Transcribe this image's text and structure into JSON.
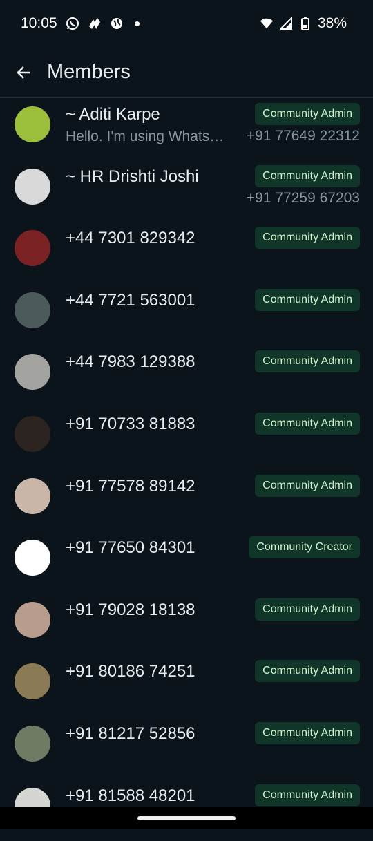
{
  "status_bar": {
    "time": "10:05",
    "battery": "38%",
    "icons": [
      "whatsapp-icon",
      "app-icon",
      "globe-icon",
      "dot-icon",
      "wifi-icon",
      "signal-icon",
      "battery-icon"
    ]
  },
  "header": {
    "title": "Members",
    "back_icon": "arrow-left-icon"
  },
  "members": [
    {
      "name": "~ Aditi Karpe",
      "about": "Hello. I'm using WhatsApp.",
      "badge": "Community Admin",
      "phone": "+91 77649 22312",
      "avatar_color": "#9bbf3a"
    },
    {
      "name": "~ HR Drishti Joshi",
      "about": "",
      "badge": "Community Admin",
      "phone": "+91 77259 67203",
      "avatar_color": "#d9d9d9"
    },
    {
      "name": "+44 7301 829342",
      "about": "",
      "badge": "Community Admin",
      "phone": "",
      "avatar_color": "#7a2224"
    },
    {
      "name": "+44 7721 563001",
      "about": "",
      "badge": "Community Admin",
      "phone": "",
      "avatar_color": "#4d5a5c"
    },
    {
      "name": "+44 7983 129388",
      "about": "",
      "badge": "Community Admin",
      "phone": "",
      "avatar_color": "#a3a3a0"
    },
    {
      "name": "+91 70733 81883",
      "about": "",
      "badge": "Community Admin",
      "phone": "",
      "avatar_color": "#2b2420"
    },
    {
      "name": "+91 77578 89142",
      "about": "",
      "badge": "Community Admin",
      "phone": "",
      "avatar_color": "#c9b6a8"
    },
    {
      "name": "+91 77650 84301",
      "about": "",
      "badge": "Community Creator",
      "phone": "",
      "avatar_color": "#ffffff"
    },
    {
      "name": "+91 79028 18138",
      "about": "",
      "badge": "Community Admin",
      "phone": "",
      "avatar_color": "#b89d8f"
    },
    {
      "name": "+91 80186 74251",
      "about": "",
      "badge": "Community Admin",
      "phone": "",
      "avatar_color": "#8a7a55"
    },
    {
      "name": "+91 81217 52856",
      "about": "",
      "badge": "Community Admin",
      "phone": "",
      "avatar_color": "#6f7b62"
    },
    {
      "name": "+91 81588 48201",
      "about": "",
      "badge": "Community Admin",
      "phone": "",
      "avatar_color": "#d4d4d0"
    }
  ],
  "colors": {
    "background": "#0b141a",
    "badge_bg": "#103529",
    "badge_text": "#d1f4cc",
    "secondary_text": "#8696a0"
  }
}
